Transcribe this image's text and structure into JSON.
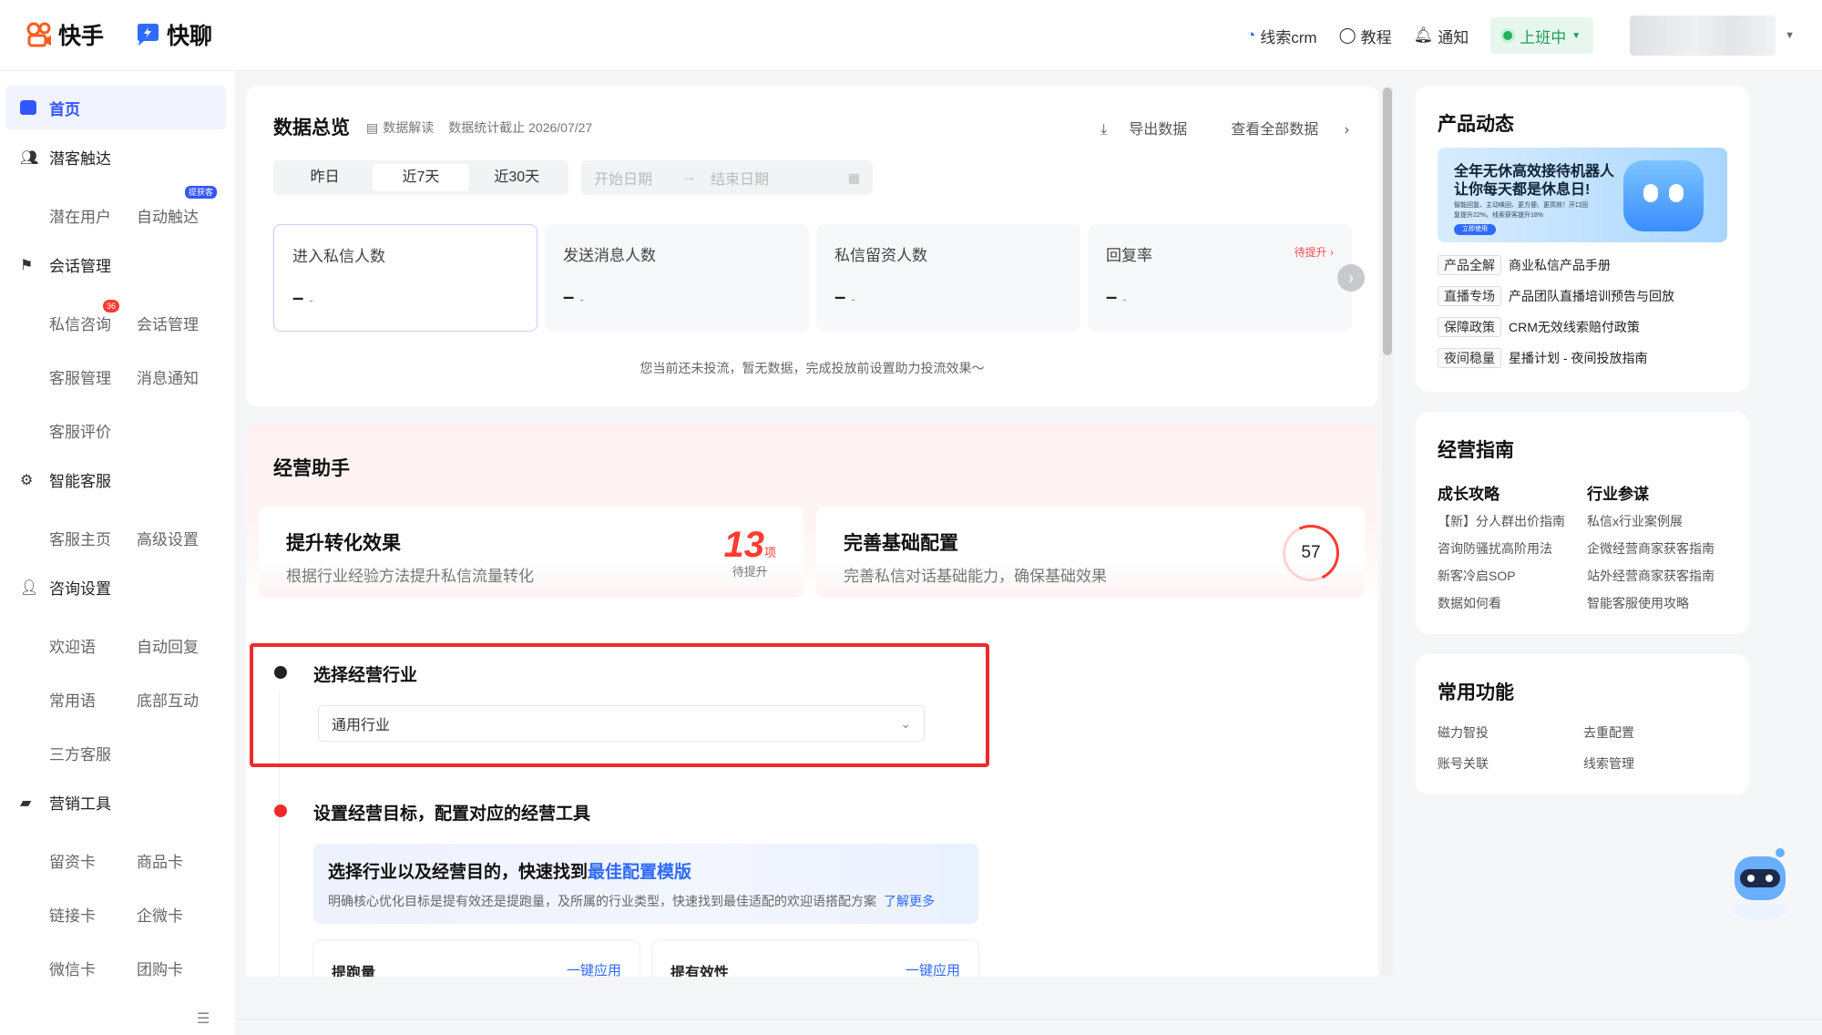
{
  "header": {
    "logo_kuaishou": "快手",
    "logo_kuailiao": "快聊",
    "links": [
      {
        "label": "线索crm",
        "icon": "crm-icon"
      },
      {
        "label": "教程",
        "icon": "tutorial-icon"
      },
      {
        "label": "通知",
        "icon": "bell-icon"
      }
    ],
    "status": "上班中"
  },
  "sidebar": {
    "home": "首页",
    "groups": [
      {
        "label": "潜客触达",
        "icon": "users-icon",
        "items": [
          "潜在用户",
          "自动触达"
        ],
        "badge": "提获客"
      },
      {
        "label": "会话管理",
        "icon": "flag-icon",
        "items": [
          "私信咨询",
          "会话管理",
          "客服管理",
          "消息通知",
          "客服评价"
        ],
        "badge": "36"
      },
      {
        "label": "智能客服",
        "icon": "robot-icon",
        "items": [
          "客服主页",
          "高级设置"
        ]
      },
      {
        "label": "咨询设置",
        "icon": "user-settings-icon",
        "items": [
          "欢迎语",
          "自动回复",
          "常用语",
          "底部互动",
          "三方客服"
        ]
      },
      {
        "label": "营销工具",
        "icon": "folder-icon",
        "items": [
          "留资卡",
          "商品卡",
          "链接卡",
          "企微卡",
          "微信卡",
          "团购卡"
        ]
      }
    ]
  },
  "overview": {
    "title": "数据总览",
    "interpret": "数据解读",
    "stat_date": "数据统计截止 2026/07/27",
    "export": "导出数据",
    "view_all": "查看全部数据",
    "ranges": [
      "昨日",
      "近7天",
      "近30天"
    ],
    "active_range": "近7天",
    "start_placeholder": "开始日期",
    "end_placeholder": "结束日期",
    "metrics": [
      {
        "label": "进入私信人数",
        "value": "–",
        "sub": "-"
      },
      {
        "label": "发送消息人数",
        "value": "–",
        "sub": "-"
      },
      {
        "label": "私信留资人数",
        "value": "–",
        "sub": "-"
      },
      {
        "label": "回复率",
        "value": "–",
        "sub": "-",
        "extra": "待提升"
      }
    ],
    "note": "您当前还未投流，暂无数据，完成投放前设置助力投流效果～"
  },
  "assistant": {
    "title": "经营助手",
    "boost": {
      "title": "提升转化效果",
      "desc": "根据行业经验方法提升私信流量转化",
      "count": "13",
      "unit": "项",
      "count_label": "待提升"
    },
    "config": {
      "title": "完善基础配置",
      "desc": "完善私信对话基础能力，确保基础效果",
      "score": "57"
    },
    "step1": {
      "title": "选择经营行业",
      "select_value": "通用行业"
    },
    "step2": {
      "title": "设置经营目标，配置对应的经营工具"
    },
    "tip": {
      "title_prefix": "选择行业以及经营目的，快速找到",
      "title_highlight": "最佳配置模版",
      "desc": "明确核心优化目标是提有效还是提跑量，及所属的行业类型，快速找到最佳适配的欢迎语搭配方案",
      "more": "了解更多"
    },
    "cards": [
      {
        "left": "提跑量",
        "right": "一键应用"
      },
      {
        "left": "提有效性",
        "right": "一键应用"
      }
    ]
  },
  "product_news": {
    "title": "产品动态",
    "banner_line1": "全年无休高效接待机器人",
    "banner_line2": "让你每天都是休息日!",
    "banner_small": "智能回复、主动唤回、更方便、更高效！开口回复提升22%，线索获客提升18%",
    "banner_button": "立即使用",
    "items": [
      {
        "tag": "产品全解",
        "text": "商业私信产品手册"
      },
      {
        "tag": "直播专场",
        "text": "产品团队直播培训预告与回放"
      },
      {
        "tag": "保障政策",
        "text": "CRM无效线索赔付政策"
      },
      {
        "tag": "夜间稳量",
        "text": "星播计划 - 夜间投放指南"
      }
    ]
  },
  "guide": {
    "title": "经营指南",
    "col1_title": "成长攻略",
    "col1": [
      "【新】分人群出价指南",
      "咨询防骚扰高阶用法",
      "新客冷启SOP",
      "数据如何看"
    ],
    "col2_title": "行业参谋",
    "col2": [
      "私信x行业案例展",
      "企微经营商家获客指南",
      "站外经营商家获客指南",
      "智能客服使用攻略"
    ]
  },
  "common": {
    "title": "常用功能",
    "items": [
      "磁力智投",
      "去重配置",
      "账号关联",
      "线索管理"
    ]
  },
  "colors": {
    "brand": "#3456ff",
    "alert": "#ff3b30",
    "highlight_border": "#f02a2a",
    "status_green": "#1f9d55"
  }
}
